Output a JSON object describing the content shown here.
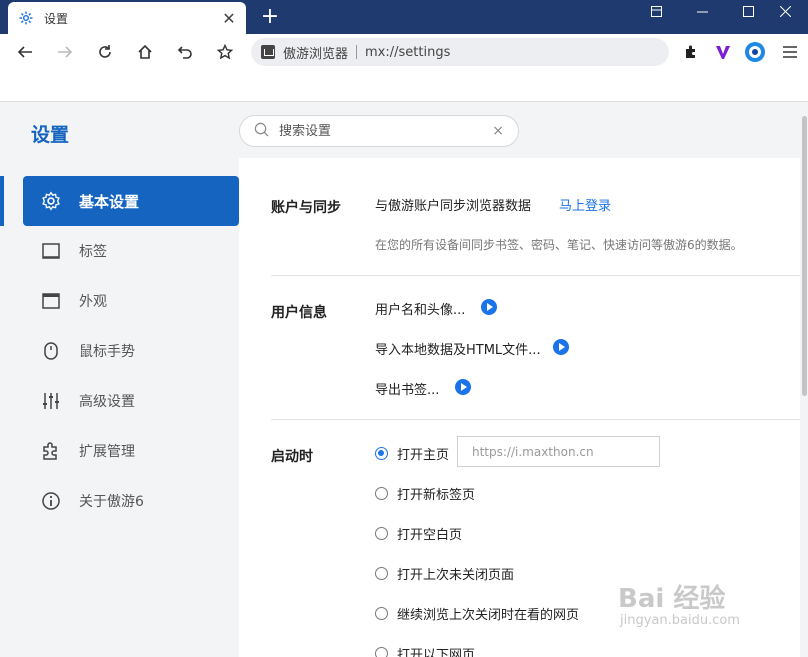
{
  "tab": {
    "title": "设置",
    "close_icon": "close-icon"
  },
  "newtab_label": "+",
  "omnibox": {
    "site_name": "傲游浏览器",
    "url": "mx://settings"
  },
  "settings": {
    "title": "设置",
    "search_placeholder": "搜索设置",
    "search_clear": "×"
  },
  "nav": {
    "items": [
      {
        "label": "基本设置",
        "icon": "gear-icon",
        "active": true
      },
      {
        "label": "标签",
        "icon": "tab-icon",
        "active": false
      },
      {
        "label": "外观",
        "icon": "window-icon",
        "active": false
      },
      {
        "label": "鼠标手势",
        "icon": "mouse-icon",
        "active": false
      },
      {
        "label": "高级设置",
        "icon": "sliders-icon",
        "active": false
      },
      {
        "label": "扩展管理",
        "icon": "puzzle-icon",
        "active": false
      },
      {
        "label": "关于傲游6",
        "icon": "info-icon",
        "active": false
      }
    ]
  },
  "account": {
    "heading": "账户与同步",
    "sync_text": "与傲游账户同步浏览器数据",
    "login_link": "马上登录",
    "description": "在您的所有设备间同步书签、密码、笔记、快速访问等傲游6的数据。"
  },
  "user_info": {
    "heading": "用户信息",
    "rows": [
      "用户名和头像...",
      "导入本地数据及HTML文件...",
      "导出书签..."
    ]
  },
  "startup": {
    "heading": "启动时",
    "options": [
      {
        "label": "打开主页",
        "checked": true
      },
      {
        "label": "打开新标签页",
        "checked": false
      },
      {
        "label": "打开空白页",
        "checked": false
      },
      {
        "label": "打开上次未关闭页面",
        "checked": false
      },
      {
        "label": "继续浏览上次关闭时在看的网页",
        "checked": false
      },
      {
        "label": "打开以下网页",
        "checked": false
      }
    ],
    "homepage_value": "https://i.maxthon.cn"
  },
  "watermark": {
    "logo": "Bai 经验",
    "url": "jingyan.baidu.com"
  },
  "colors": {
    "accent": "#1565c0",
    "link": "#1a73e8",
    "titlebar": "#1f3a6e"
  }
}
